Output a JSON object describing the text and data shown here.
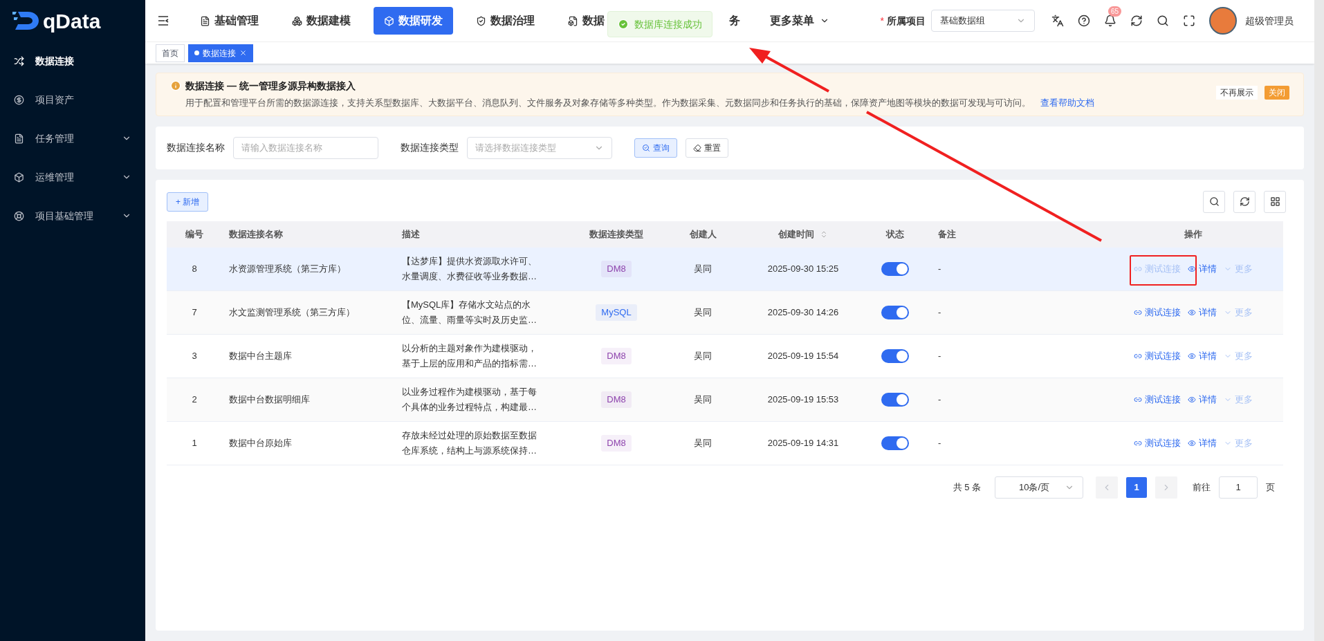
{
  "brand": "qData",
  "sidebar": {
    "items": [
      {
        "label": "数据连接",
        "selected": true,
        "expandable": false
      },
      {
        "label": "项目资产",
        "selected": false,
        "expandable": false
      },
      {
        "label": "任务管理",
        "selected": false,
        "expandable": true
      },
      {
        "label": "运维管理",
        "selected": false,
        "expandable": true
      },
      {
        "label": "项目基础管理",
        "selected": false,
        "expandable": true
      }
    ]
  },
  "topnav": {
    "items": [
      {
        "label": "基础管理",
        "selected": false
      },
      {
        "label": "数据建模",
        "selected": false
      },
      {
        "label": "数据研发",
        "selected": true
      },
      {
        "label": "数据治理",
        "selected": false
      },
      {
        "label": "数据",
        "selected": false
      },
      {
        "label": "务",
        "selected": false
      }
    ],
    "more": "更多菜单"
  },
  "project": {
    "required_mark": "*",
    "label": "所属项目",
    "value": "基础数据组"
  },
  "notifications": "65",
  "user": "超级管理员",
  "toast": "数据库连接成功",
  "page_tabs": [
    {
      "label": "首页",
      "selected": false
    },
    {
      "label": "数据连接",
      "selected": true
    }
  ],
  "notice": {
    "title": "数据连接 — 统一管理多源异构数据接入",
    "text": "用于配置和管理平台所需的数据源连接，支持关系型数据库、大数据平台、消息队列、文件服务及对象存储等多种类型。作为数据采集、元数据同步和任务执行的基础，保障资产地图等模块的数据可发现与可访问。",
    "link": "查看帮助文档",
    "hide": "不再展示",
    "close": "关闭"
  },
  "filters": [
    {
      "label": "数据连接名称",
      "placeholder": "请输入数据连接名称",
      "kind": "input"
    },
    {
      "label": "数据连接类型",
      "placeholder": "请选择数据连接类型",
      "kind": "select"
    }
  ],
  "query": "查询",
  "reset": "重置",
  "add": "+ 新增",
  "table": {
    "columns": [
      "编号",
      "数据连接名称",
      "描述",
      "数据连接类型",
      "创建人",
      "创建时间",
      "状态",
      "备注",
      "操作"
    ],
    "rows": [
      {
        "id": "8",
        "name": "水资源管理系统（第三方库）",
        "desc": [
          "【达梦库】提供水资源取水许可、",
          "水量调度、水费征收等业务数据…"
        ],
        "type": {
          "label": "DM8",
          "color": "#8e44ad"
        },
        "creator": "吴同",
        "created": "2025-09-30 15:25",
        "on": true,
        "note": "-",
        "selected": true,
        "actions": {
          "test": "测试连接",
          "test_disabled": true,
          "detail": "详情",
          "more": "更多"
        }
      },
      {
        "id": "7",
        "name": "水文监测管理系统（第三方库）",
        "desc": [
          "【MySQL库】存储水文站点的水",
          "位、流量、雨量等实时及历史监…"
        ],
        "type": {
          "label": "MySQL",
          "color": "#2f6bf0"
        },
        "creator": "吴同",
        "created": "2025-09-30 14:26",
        "on": true,
        "note": "-",
        "selected": false,
        "actions": {
          "test": "测试连接",
          "test_disabled": false,
          "detail": "详情",
          "more": "更多"
        }
      },
      {
        "id": "3",
        "name": "数据中台主题库",
        "desc": [
          "以分析的主题对象作为建模驱动，",
          "基于上层的应用和产品的指标需…"
        ],
        "type": {
          "label": "DM8",
          "color": "#8e44ad"
        },
        "creator": "吴同",
        "created": "2025-09-19 15:54",
        "on": true,
        "note": "-",
        "selected": false,
        "actions": {
          "test": "测试连接",
          "test_disabled": false,
          "detail": "详情",
          "more": "更多"
        }
      },
      {
        "id": "2",
        "name": "数据中台数据明细库",
        "desc": [
          "以业务过程作为建模驱动，基于每",
          "个具体的业务过程特点，构建最…"
        ],
        "type": {
          "label": "DM8",
          "color": "#8e44ad"
        },
        "creator": "吴同",
        "created": "2025-09-19 15:53",
        "on": true,
        "note": "-",
        "selected": false,
        "actions": {
          "test": "测试连接",
          "test_disabled": false,
          "detail": "详情",
          "more": "更多"
        }
      },
      {
        "id": "1",
        "name": "数据中台原始库",
        "desc": [
          "存放未经过处理的原始数据至数据",
          "仓库系统，结构上与源系统保持…"
        ],
        "type": {
          "label": "DM8",
          "color": "#8e44ad"
        },
        "creator": "吴同",
        "created": "2025-09-19 14:31",
        "on": true,
        "note": "-",
        "selected": false,
        "actions": {
          "test": "测试连接",
          "test_disabled": false,
          "detail": "详情",
          "more": "更多"
        }
      }
    ]
  },
  "pagination": {
    "total": "共 5 条",
    "page_size": "10条/页",
    "pages": [
      {
        "label": "1",
        "selected": true
      }
    ],
    "goto": "前往",
    "goto_value": "1",
    "page_unit": "页"
  }
}
